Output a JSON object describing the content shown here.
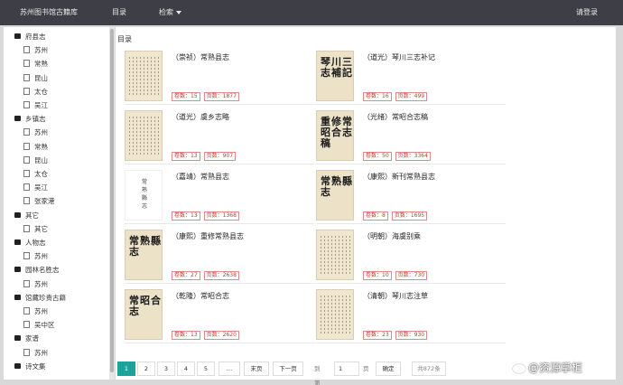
{
  "navbar": {
    "brand": "苏州图书馆古籍库",
    "dir": "目录",
    "search": "检索",
    "login": "请登录"
  },
  "sidebar": {
    "items": [
      {
        "label": "府县志",
        "type": "folder"
      },
      {
        "label": "苏州",
        "type": "file"
      },
      {
        "label": "常熟",
        "type": "file"
      },
      {
        "label": "昆山",
        "type": "file"
      },
      {
        "label": "太仓",
        "type": "file"
      },
      {
        "label": "吴江",
        "type": "file"
      },
      {
        "label": "乡镇志",
        "type": "folder"
      },
      {
        "label": "苏州",
        "type": "file"
      },
      {
        "label": "常熟",
        "type": "file"
      },
      {
        "label": "昆山",
        "type": "file"
      },
      {
        "label": "太仓",
        "type": "file"
      },
      {
        "label": "吴江",
        "type": "file"
      },
      {
        "label": "张家港",
        "type": "file"
      },
      {
        "label": "其它",
        "type": "folder"
      },
      {
        "label": "其它",
        "type": "file"
      },
      {
        "label": "人物志",
        "type": "folder"
      },
      {
        "label": "苏州",
        "type": "file"
      },
      {
        "label": "园林名胜志",
        "type": "folder"
      },
      {
        "label": "苏州",
        "type": "file"
      },
      {
        "label": "馆藏珍贵古籍",
        "type": "folder"
      },
      {
        "label": "苏州",
        "type": "file"
      },
      {
        "label": "吴中区",
        "type": "file"
      },
      {
        "label": "家谱",
        "type": "folder"
      },
      {
        "label": "苏州",
        "type": "file"
      },
      {
        "label": "诗文集",
        "type": "folder"
      }
    ]
  },
  "main": {
    "title": "目录",
    "books": [
      {
        "title": "（崇祯）常熟县志",
        "juan": "卷数：15",
        "pages": "页数：1877",
        "cover": "cols"
      },
      {
        "title": "（道光）琴川三志补记",
        "juan": "卷数：16",
        "pages": "页数：499",
        "cover": "琴川三志補記"
      },
      {
        "title": "（道光）虞乡志略",
        "juan": "卷数：13",
        "pages": "页数：907",
        "cover": "cols"
      },
      {
        "title": "（光绪）常昭合志稿",
        "juan": "卷数：50",
        "pages": "页数：3364",
        "cover": "重修常昭合志稿"
      },
      {
        "title": "（嘉靖）常熟县志",
        "juan": "卷数：13",
        "pages": "页数：1368",
        "cover": "常熟縣志"
      },
      {
        "title": "（康熙）新刊常熟县志",
        "juan": "卷数：8",
        "pages": "页数：1695",
        "cover": "常熟縣志"
      },
      {
        "title": "（康熙）重修常熟县志",
        "juan": "卷数：27",
        "pages": "页数：2638",
        "cover": "常熟縣志"
      },
      {
        "title": "（明朝）海虞别乘",
        "juan": "卷数：10",
        "pages": "页数：730",
        "cover": "cols"
      },
      {
        "title": "（乾隆）常昭合志",
        "juan": "卷数：13",
        "pages": "页数：2620",
        "cover": "常昭合志"
      },
      {
        "title": "（清朝）琴川志注草",
        "juan": "卷数：23",
        "pages": "页数：930",
        "cover": "cols"
      }
    ]
  },
  "pager": {
    "pages": [
      "1",
      "2",
      "3",
      "4",
      "5"
    ],
    "ellipsis": "…",
    "last": "末页",
    "next": "下一页",
    "goto_label": "到第",
    "page_value": "1",
    "page_unit": "页",
    "confirm": "确定",
    "total": "共872条"
  },
  "watermark": "@资源掌柜"
}
